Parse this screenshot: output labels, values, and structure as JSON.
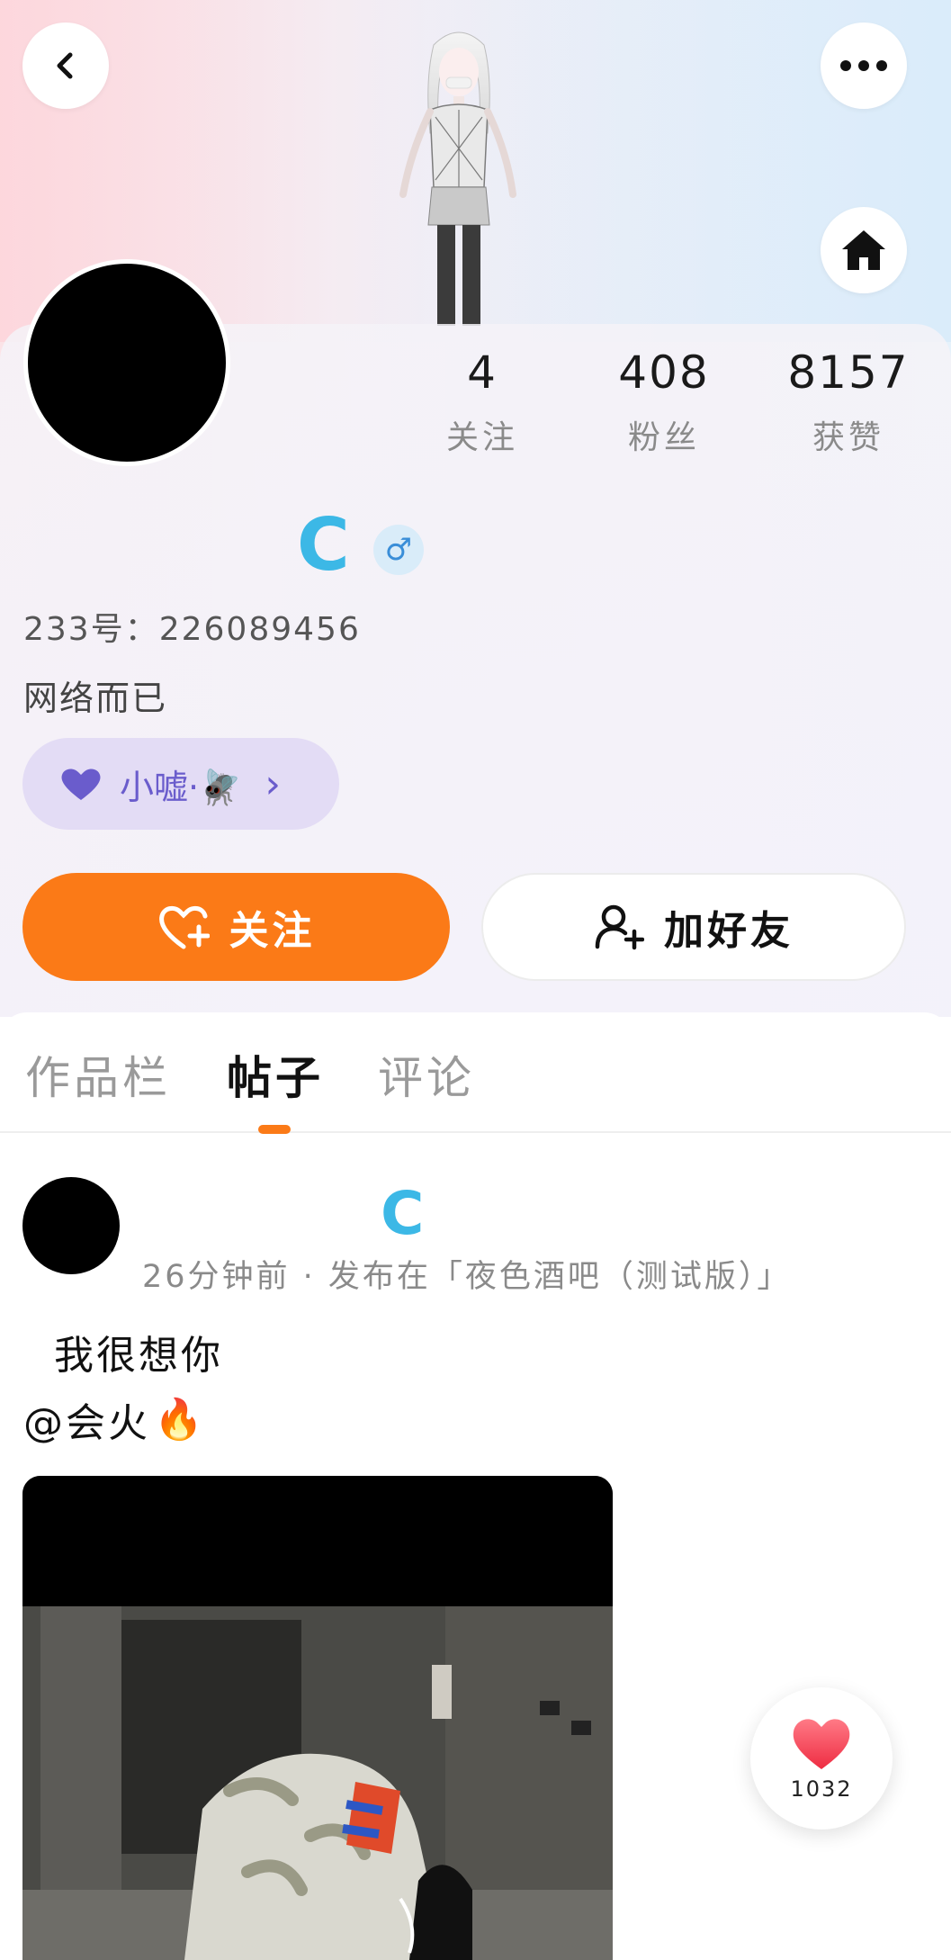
{
  "header": {
    "back_icon": "chevron-left-icon",
    "more_icon": "more-dots-icon",
    "home_icon": "home-icon"
  },
  "profile": {
    "verified_mark": "C",
    "gender_symbol": "♂",
    "uid": "233号：226089456",
    "bio": "网络而已",
    "tag": {
      "label": "小嘘·🪰",
      "heart_icon": "purple-heart-icon",
      "arrow": "›"
    }
  },
  "stats": [
    {
      "value": "4",
      "label": "关注"
    },
    {
      "value": "408",
      "label": "粉丝"
    },
    {
      "value": "8157",
      "label": "获赞"
    }
  ],
  "actions": {
    "follow_label": "关注",
    "add_friend_label": "加好友"
  },
  "tabs": [
    {
      "label": "作品栏",
      "active": false
    },
    {
      "label": "帖子",
      "active": true
    },
    {
      "label": "评论",
      "active": false
    }
  ],
  "post": {
    "verified_mark": "C",
    "meta": "26分钟前 · 发布在「夜色酒吧（测试版）」",
    "line1": "  我很想你",
    "line2_mention": "@会火",
    "line2_emoji": "🔥"
  },
  "like": {
    "count": "1032"
  },
  "colors": {
    "accent": "#fb7a17",
    "verified": "#3cb8e6",
    "tag_bg": "#e3dcf5",
    "tag_text": "#6a5ccc"
  }
}
